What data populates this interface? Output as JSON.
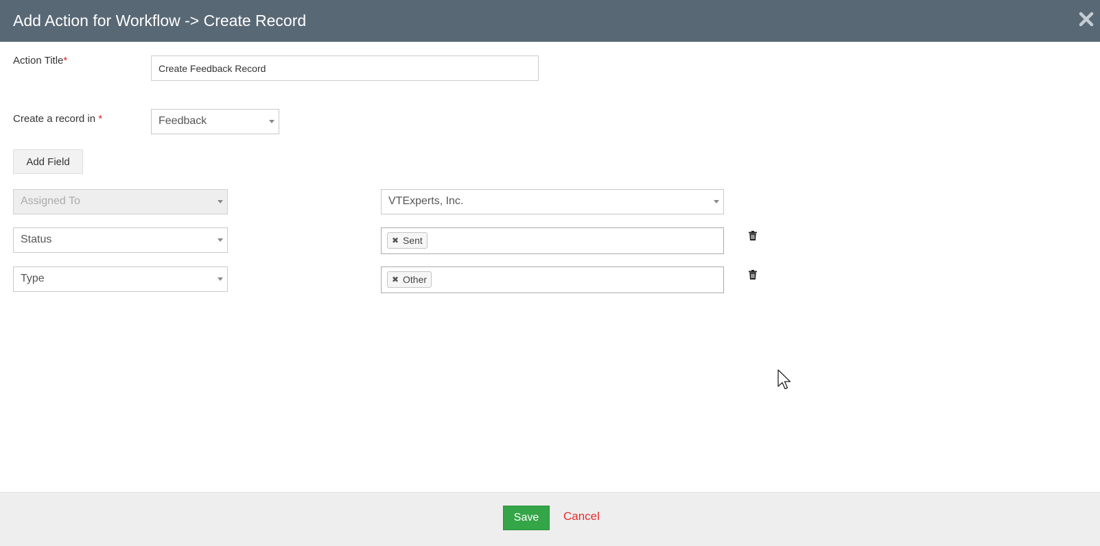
{
  "modal": {
    "title": "Add Action for Workflow -> Create Record",
    "close_icon": "close-icon"
  },
  "form": {
    "action_title": {
      "label": "Action Title",
      "required_mark": "*",
      "value": "Create Feedback Record"
    },
    "create_record": {
      "label": "Create a record in",
      "required_mark": "*",
      "selected": "Feedback"
    },
    "add_field_label": "Add Field",
    "field_rows": [
      {
        "field": "Assigned To",
        "field_disabled": true,
        "value": "VTExperts, Inc.",
        "value_type": "select",
        "deletable": false
      },
      {
        "field": "Status",
        "field_disabled": false,
        "value": "Sent",
        "value_type": "tags",
        "deletable": true
      },
      {
        "field": "Type",
        "field_disabled": false,
        "value": "Other",
        "value_type": "tags",
        "deletable": true
      }
    ]
  },
  "footer": {
    "save_label": "Save",
    "cancel_label": "Cancel"
  },
  "colors": {
    "header_bg": "#596875",
    "save_bg": "#35a648",
    "cancel_text": "#e32d2d",
    "required": "#e02020"
  }
}
